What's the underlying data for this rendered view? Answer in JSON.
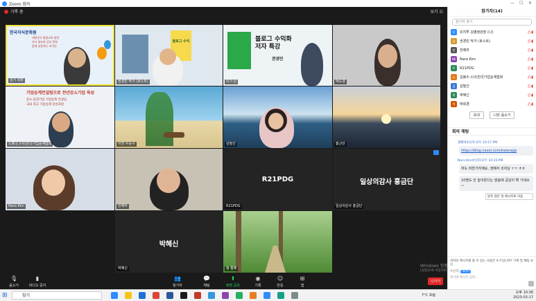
{
  "window": {
    "title": "Zoom 회의",
    "recording_label": "기록 중",
    "view_label": "보기"
  },
  "tiles": [
    {
      "name": "김기 회장",
      "slide_title": "한국지식문화원",
      "slide_lines": [
        "대한민국 평생교육 발전",
        "지식 창조와 공유 문화",
        "함께 성장하는 지식인"
      ]
    },
    {
      "name": "권경민 작가 (호스트)",
      "book_title": "네이버 블로그 수익화",
      "book_sub": "블로그 수익"
    },
    {
      "name": "이기 은",
      "book_title": "블로그 수익화",
      "book_sub": "저자 특강",
      "book_author": "권경민"
    },
    {
      "name": "박도경"
    },
    {
      "name": "노병국 /(사)한국가업승계협회",
      "slide_title": "가업승계컨설팅으로 전년강소기업 육성",
      "slide_lines": [
        "중소·중견기업 가업승계 컨설팅",
        "국내 최고 가업승계 양성과정"
      ]
    },
    {
      "name": "이연 우승구"
    },
    {
      "name": "김필선"
    },
    {
      "name": "홍근단"
    },
    {
      "name": "Nara Kim"
    },
    {
      "name": "한예자"
    },
    {
      "name": "R21PDG",
      "big": "R21PDG"
    },
    {
      "name": "일상의감사 홍금단",
      "big": "일상의감사 홍금단"
    },
    {
      "name": "박혜신",
      "big": "박혜신"
    },
    {
      "name": "정 황혜"
    }
  ],
  "toolbar": {
    "mute": "음소거",
    "video": "비디오 중지",
    "participants": "참가자",
    "participants_count": "14",
    "chat": "채팅",
    "share": "화면 공유",
    "record": "기록",
    "reactions": "반응",
    "apps": "앱",
    "end": "나가기"
  },
  "panel": {
    "participants_title": "참가자(14)",
    "search_placeholder": "참가자 찾기",
    "participants": [
      {
        "name": "유지투 김병정원장 (나)",
        "color": "#2d8cff",
        "initial": "유"
      },
      {
        "name": "권경민 작가 (호스트)",
        "color": "#d69a2b",
        "initial": "권"
      },
      {
        "name": "한예자",
        "color": "#555555",
        "initial": "한"
      },
      {
        "name": "Nara Kim",
        "color": "#8e44ad",
        "initial": "NK"
      },
      {
        "name": "R21PDG",
        "color": "#2e8b57",
        "initial": "R"
      },
      {
        "name": "김봉수 /(사)한국가업승계협회",
        "color": "#e07b1f",
        "initial": "노"
      },
      {
        "name": "김필선",
        "color": "#3a7bd5",
        "initial": "김"
      },
      {
        "name": "박혜신",
        "color": "#2e8b57",
        "initial": "박"
      },
      {
        "name": "박희경",
        "color": "#d35400",
        "initial": "박"
      }
    ],
    "invite_label": "초대",
    "mute_all_label": "나만 음소거",
    "chat_title": "회의 채팅",
    "chat_messages": [
      {
        "from": "권예자수신자:모두",
        "time": "10:17 PM",
        "text": "https://blog.naver.com/kwonajja",
        "link": true
      },
      {
        "from": "Nara Kim수신자:모두",
        "time": "10:33 PM",
        "text": "저도 마찬가지예요, 권예자 코치님 ㅜㅜ ㅎㅎ",
        "link": false
      },
      {
        "from": "",
        "time": "",
        "text": "10명도 안 늘어온다는 말씀에 공감이 확 가네요~",
        "link": false
      }
    ],
    "unread_label": "읽지 않은 첫 메시지로 이동",
    "notice_text": "귀하의 메시지를 볼 수 있는 사람은 누구입니까? 기록 및 채팅 요약",
    "to_label": "수신자:",
    "to_value": "모두",
    "input_placeholder": "여기에 메시지 입력..."
  },
  "watermark": {
    "line1": "Windows 정품 인증",
    "line2": "[설정]으로 이동하여 Windows를 정품 인증합니다."
  },
  "taskbar": {
    "search_placeholder": "찾기",
    "weather": "7°C 흐림",
    "time": "오후 10:36",
    "date": "2023-03-17"
  }
}
